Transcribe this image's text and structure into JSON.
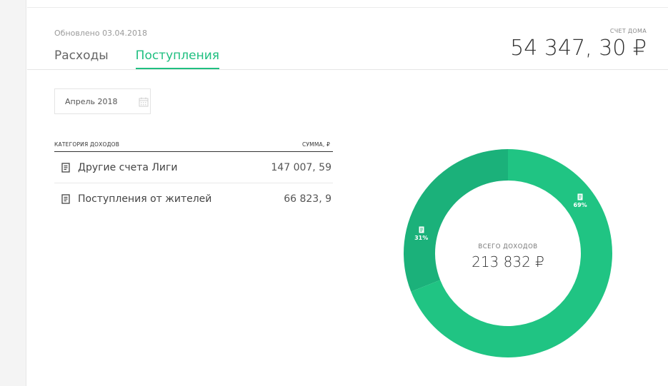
{
  "header": {
    "updated": "Обновлено 03.04.2018",
    "tabs": [
      {
        "label": "Расходы",
        "active": false
      },
      {
        "label": "Поступления",
        "active": true
      }
    ],
    "balance_label": "СЧЕТ ДОМА",
    "balance_value": "54 347, 30 ₽"
  },
  "filter": {
    "date_value": "Апрель 2018",
    "calendar_icon": "calendar-icon"
  },
  "table": {
    "col_category": "КАТЕГОРИЯ ДОХОДОВ",
    "col_sum": "СУММА, ₽",
    "rows": [
      {
        "icon": "document-icon",
        "name": "Другие счета Лиги",
        "sum": "147 007, 59"
      },
      {
        "icon": "document-icon",
        "name": "Поступления от жителей",
        "sum": "66 823, 9"
      }
    ]
  },
  "chart": {
    "center_label": "ВСЕГО ДОХОДОВ",
    "center_value": "213 832 ₽",
    "slices": [
      {
        "percent_label": "31%",
        "value": 31,
        "color": "#1bb17a"
      },
      {
        "percent_label": "69%",
        "value": 69,
        "color": "#20c483"
      }
    ]
  },
  "colors": {
    "accent": "#1fbf80"
  }
}
